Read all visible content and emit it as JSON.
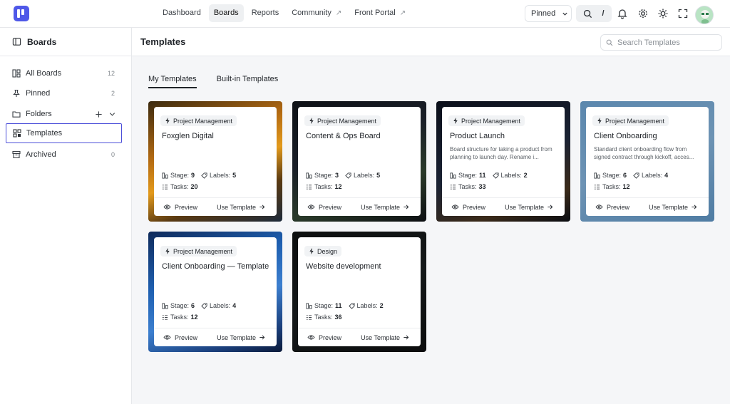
{
  "nav": {
    "items": [
      {
        "label": "Dashboard",
        "active": false,
        "external": false
      },
      {
        "label": "Boards",
        "active": true,
        "external": false
      },
      {
        "label": "Reports",
        "active": false,
        "external": false
      },
      {
        "label": "Community",
        "active": false,
        "external": true
      },
      {
        "label": "Front Portal",
        "active": false,
        "external": true
      }
    ],
    "pinned_label": "Pinned",
    "search_shortcut": "/"
  },
  "sidebar": {
    "title": "Boards",
    "items": [
      {
        "label": "All Boards",
        "count": "12",
        "icon": "grid-icon"
      },
      {
        "label": "Pinned",
        "count": "2",
        "icon": "pin-icon"
      },
      {
        "label": "Folders",
        "count": "",
        "icon": "folder-icon"
      },
      {
        "label": "Templates",
        "count": "",
        "icon": "template-icon",
        "active": true
      },
      {
        "label": "Archived",
        "count": "0",
        "icon": "archive-icon"
      }
    ]
  },
  "main": {
    "title": "Templates",
    "search_placeholder": "Search Templates",
    "tabs": [
      {
        "label": "My Templates",
        "active": true
      },
      {
        "label": "Built-in Templates",
        "active": false
      }
    ]
  },
  "labels": {
    "stage": "Stage:",
    "labels": "Labels:",
    "tasks": "Tasks:",
    "preview": "Preview",
    "use_template": "Use Template"
  },
  "cards": [
    {
      "tag": "Project Management",
      "title": "Foxglen Digital",
      "desc": "",
      "stage": "9",
      "labels": "5",
      "tasks": "20",
      "theme": "orange"
    },
    {
      "tag": "Project Management",
      "title": "Content & Ops Board",
      "desc": "",
      "stage": "3",
      "labels": "5",
      "tasks": "12",
      "theme": "dark"
    },
    {
      "tag": "Project Management",
      "title": "Product Launch",
      "desc": "Board structure for taking a product from planning to launch day. Rename i...",
      "stage": "11",
      "labels": "2",
      "tasks": "33",
      "theme": "night"
    },
    {
      "tag": "Project Management",
      "title": "Client Onboarding",
      "desc": "Standard client onboarding flow from signed contract through kickoff, acces...",
      "stage": "6",
      "labels": "4",
      "tasks": "12",
      "theme": "steel"
    },
    {
      "tag": "Project Management",
      "title": "Client Onboarding — Template",
      "desc": "",
      "stage": "6",
      "labels": "4",
      "tasks": "12",
      "theme": "blue"
    },
    {
      "tag": "Design",
      "title": "Website development",
      "desc": "",
      "stage": "11",
      "labels": "2",
      "tasks": "36",
      "theme": "black"
    }
  ],
  "colors": {
    "accent": "#4f58e8",
    "active_border": "#4c4fd9",
    "themes": {
      "orange": "linear-gradient(160deg,#3b2a10 0%,#b36a12 35%,#e39a1c 55%,#5a3a12 75%,#1d2a3a 100%)",
      "dark": "linear-gradient(160deg,#0e1116 0%,#1a1f28 40%,#2a3a2a 70%,#0d0f12 100%)",
      "night": "linear-gradient(160deg,#0b0f1a 0%,#1a2233 50%,#3a2a1a 80%,#0b0d12 100%)",
      "steel": "linear-gradient(160deg,#5b87ad 0%,#6d93b4 50%,#4f7ca3 100%)",
      "blue": "linear-gradient(160deg,#0f2a5a 0%,#1e5fb0 35%,#3c7fcf 60%,#1a3e7a 85%,#0b1a3a 100%)",
      "black": "linear-gradient(160deg,#0d0f0f 0%,#15191a 50%,#0b0c0d 100%)"
    }
  }
}
